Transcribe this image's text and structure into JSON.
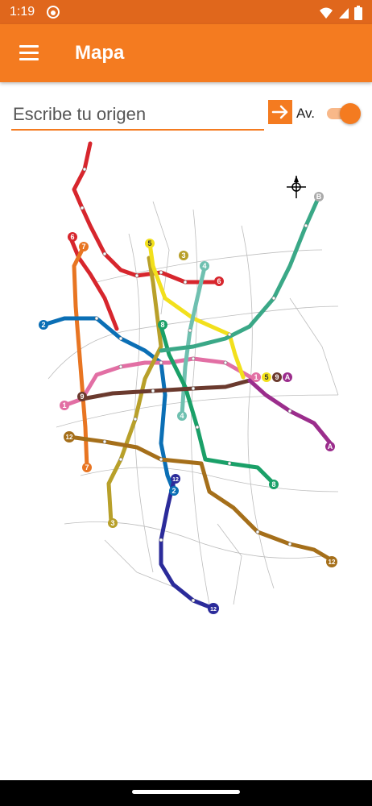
{
  "status_bar": {
    "time": "1:19"
  },
  "app_bar": {
    "title": "Mapa"
  },
  "search": {
    "placeholder": "Escribe tu origen",
    "value": "",
    "advanced_label": "Av."
  },
  "colors": {
    "accent": "#f47b20",
    "status_bar": "#e0671c"
  },
  "map": {
    "lines": [
      {
        "id": "1",
        "color": "#e26fa4"
      },
      {
        "id": "2",
        "color": "#0b6fb5"
      },
      {
        "id": "3",
        "color": "#b8a02a"
      },
      {
        "id": "4",
        "color": "#6fc0b0"
      },
      {
        "id": "5",
        "color": "#f2e01c"
      },
      {
        "id": "6",
        "color": "#d7262d"
      },
      {
        "id": "7",
        "color": "#e87522"
      },
      {
        "id": "8",
        "color": "#1aa068"
      },
      {
        "id": "9",
        "color": "#6b3a2e"
      },
      {
        "id": "A",
        "color": "#9b2d8c"
      },
      {
        "id": "B",
        "color": "#3aa887"
      },
      {
        "id": "12",
        "color": "#a56f1a"
      }
    ]
  }
}
